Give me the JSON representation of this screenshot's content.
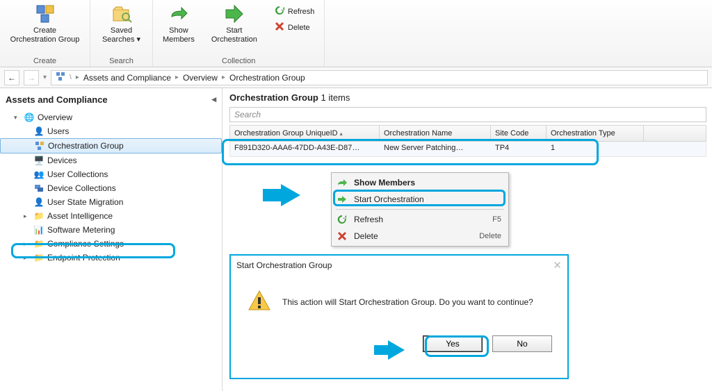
{
  "ribbon": {
    "create": {
      "label": "Create\nOrchestration Group",
      "group": "Create"
    },
    "saved": {
      "label": "Saved\nSearches ▾",
      "group": "Search"
    },
    "show": {
      "label": "Show\nMembers"
    },
    "start": {
      "label": "Start\nOrchestration"
    },
    "refresh": {
      "label": "Refresh"
    },
    "delete": {
      "label": "Delete"
    },
    "collgroup": "Collection"
  },
  "breadcrumb": {
    "items": [
      "Assets and Compliance",
      "Overview",
      "Orchestration Group"
    ]
  },
  "tree": {
    "title": "Assets and Compliance",
    "nodes": [
      {
        "label": "Overview",
        "twist": "▾"
      },
      {
        "label": "Users"
      },
      {
        "label": "Orchestration Group",
        "selected": true
      },
      {
        "label": "Devices"
      },
      {
        "label": "User Collections"
      },
      {
        "label": "Device Collections"
      },
      {
        "label": "User State Migration"
      },
      {
        "label": "Asset Intelligence",
        "twist": "▸"
      },
      {
        "label": "Software Metering"
      },
      {
        "label": "Compliance Settings",
        "twist": "▸"
      },
      {
        "label": "Endpoint Protection",
        "twist": "▸"
      }
    ]
  },
  "detail": {
    "title_a": "Orchestration Group",
    "title_b": "1 items",
    "search_placeholder": "Search",
    "columns": [
      "Orchestration Group UniqueID",
      "Orchestration Name",
      "Site Code",
      "Orchestration Type"
    ],
    "row": {
      "uid": "F891D320-AAA6-47DD-A43E-D87…",
      "name": "New Server Patching…",
      "site": "TP4",
      "type": "1"
    }
  },
  "context": {
    "items": [
      {
        "label": "Show Members",
        "bold": true,
        "icon": "share"
      },
      {
        "label": "Start Orchestration",
        "icon": "play",
        "hl": true
      },
      {
        "label": "Refresh",
        "key": "F5",
        "icon": "refresh"
      },
      {
        "label": "Delete",
        "key": "Delete",
        "icon": "del"
      }
    ]
  },
  "dialog": {
    "title": "Start Orchestration Group",
    "message": "This action will Start Orchestration Group. Do you want to continue?",
    "yes": "Yes",
    "no": "No"
  }
}
